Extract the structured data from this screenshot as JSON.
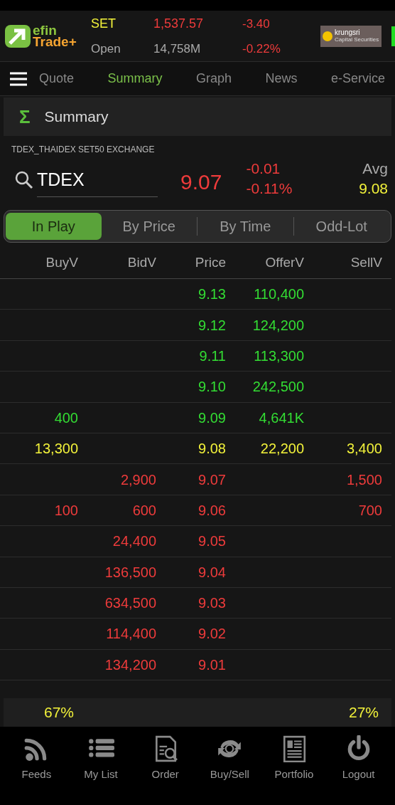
{
  "header": {
    "logo": {
      "line_1": "efin",
      "line_2": "Trade+"
    },
    "index_name": "SET",
    "index_value": "1,537.57",
    "change": "-3.40",
    "status": "Open",
    "volume": "14,758M",
    "percent": "-0.22%",
    "broker": {
      "name": "krungsri",
      "sub": "Capital Securities"
    }
  },
  "nav": {
    "tabs": [
      {
        "label": "Quote",
        "selected": false
      },
      {
        "label": "Summary",
        "selected": true
      },
      {
        "label": "Graph",
        "selected": false
      },
      {
        "label": "News",
        "selected": false
      },
      {
        "label": "e-Service",
        "selected": false
      }
    ]
  },
  "section": {
    "icon": "Σ",
    "title": "Summary"
  },
  "symbol_name": "TDEX_THAIDEX SET50 EXCHANGE",
  "quote": {
    "symbol": "TDEX",
    "last": "9.07",
    "change": "-0.01",
    "percent": "-0.11%",
    "avg_label": "Avg",
    "avg": "9.08"
  },
  "segments": [
    {
      "label": "In Play",
      "selected": true
    },
    {
      "label": "By Price",
      "selected": false
    },
    {
      "label": "By Time",
      "selected": false
    },
    {
      "label": "Odd-Lot",
      "selected": false
    }
  ],
  "table": {
    "columns": [
      "BuyV",
      "BidV",
      "Price",
      "OfferV",
      "SellV"
    ],
    "rows": [
      {
        "color": "#33dd33",
        "cells": [
          "",
          "",
          "9.13",
          "110,400",
          ""
        ]
      },
      {
        "color": "#33dd33",
        "cells": [
          "",
          "",
          "9.12",
          "124,200",
          ""
        ]
      },
      {
        "color": "#33dd33",
        "cells": [
          "",
          "",
          "9.11",
          "113,300",
          ""
        ]
      },
      {
        "color": "#33dd33",
        "cells": [
          "",
          "",
          "9.10",
          "242,500",
          ""
        ]
      },
      {
        "color": "#33dd33",
        "cells": [
          "400",
          "",
          "9.09",
          "4,641K",
          ""
        ]
      },
      {
        "color": "#f2f23a",
        "cells": [
          "13,300",
          "",
          "9.08",
          "22,200",
          "3,400"
        ]
      },
      {
        "color": "#ee3b3b",
        "cells": [
          "",
          "2,900",
          "9.07",
          "",
          "1,500"
        ]
      },
      {
        "color": "#ee3b3b",
        "cells": [
          "100",
          "600",
          "9.06",
          "",
          "700"
        ]
      },
      {
        "color": "#ee3b3b",
        "cells": [
          "",
          "24,400",
          "9.05",
          "",
          ""
        ]
      },
      {
        "color": "#ee3b3b",
        "cells": [
          "",
          "136,500",
          "9.04",
          "",
          ""
        ]
      },
      {
        "color": "#ee3b3b",
        "cells": [
          "",
          "634,500",
          "9.03",
          "",
          ""
        ]
      },
      {
        "color": "#ee3b3b",
        "cells": [
          "",
          "114,400",
          "9.02",
          "",
          ""
        ]
      },
      {
        "color": "#ee3b3b",
        "cells": [
          "",
          "134,200",
          "9.01",
          "",
          ""
        ]
      }
    ]
  },
  "totals": {
    "buy": "67%",
    "sell": "27%"
  },
  "bottom_nav": [
    {
      "kind": "feeds",
      "label": "Feeds"
    },
    {
      "kind": "list",
      "label": "My List"
    },
    {
      "kind": "order",
      "label": "Order"
    },
    {
      "kind": "buysell",
      "label": "Buy/Sell"
    },
    {
      "kind": "portfolio",
      "label": "Portfolio"
    },
    {
      "kind": "logout",
      "label": "Logout"
    }
  ]
}
